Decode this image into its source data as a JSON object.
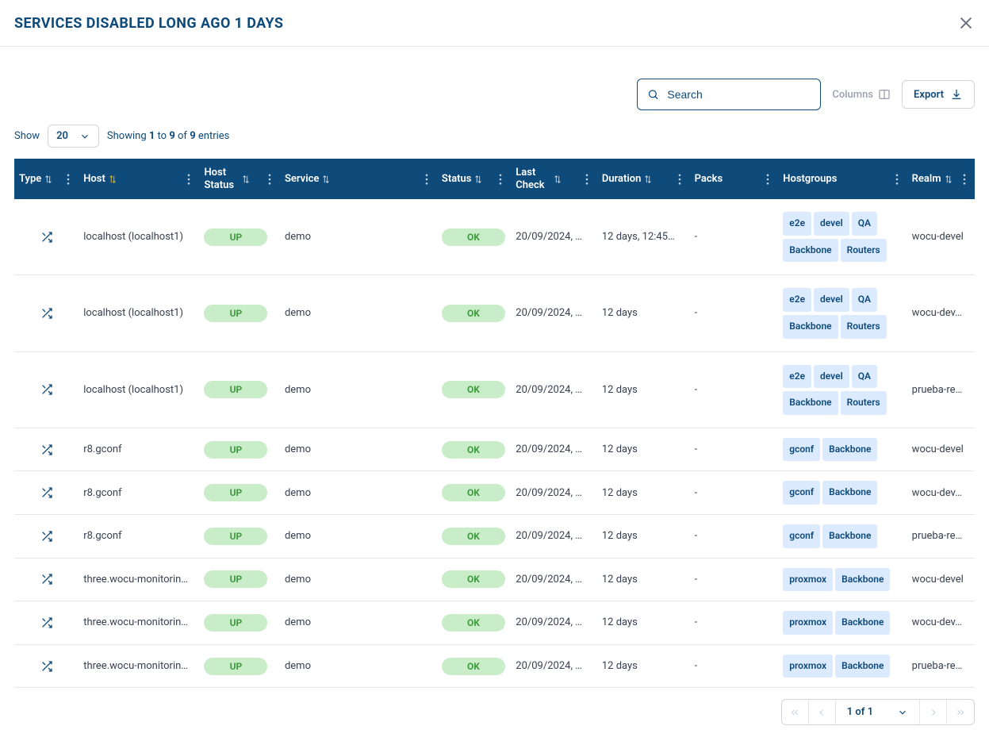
{
  "header": {
    "title": "SERVICES DISABLED LONG AGO 1 DAYS"
  },
  "toolbar": {
    "search_placeholder": "Search",
    "columns_label": "Columns",
    "export_label": "Export"
  },
  "entries": {
    "show_label": "Show",
    "show_value": "20",
    "showing_prefix": "Showing ",
    "from": "1",
    "to_word": " to ",
    "to": "9",
    "of_word": " of ",
    "total": "9",
    "entries_word": " entries"
  },
  "columns": {
    "type": "Type",
    "host": "Host",
    "host_status": "Host Status",
    "service": "Service",
    "status": "Status",
    "last_check": "Last Check",
    "duration": "Duration",
    "packs": "Packs",
    "hostgroups": "Hostgroups",
    "realm": "Realm"
  },
  "rows": [
    {
      "host": "localhost (localhost1)",
      "host_status": "UP",
      "service": "demo",
      "status": "OK",
      "last_check": "20/09/2024, …",
      "duration": "12 days, 12:45…",
      "packs": "-",
      "hostgroups": [
        "e2e",
        "devel",
        "QA",
        "Backbone",
        "Routers"
      ],
      "realm": "wocu-devel"
    },
    {
      "host": "localhost (localhost1)",
      "host_status": "UP",
      "service": "demo",
      "status": "OK",
      "last_check": "20/09/2024, …",
      "duration": "12 days",
      "packs": "-",
      "hostgroups": [
        "e2e",
        "devel",
        "QA",
        "Backbone",
        "Routers"
      ],
      "realm": "wocu-dev…"
    },
    {
      "host": "localhost (localhost1)",
      "host_status": "UP",
      "service": "demo",
      "status": "OK",
      "last_check": "20/09/2024, …",
      "duration": "12 days",
      "packs": "-",
      "hostgroups": [
        "e2e",
        "devel",
        "QA",
        "Backbone",
        "Routers"
      ],
      "realm": "prueba-re…"
    },
    {
      "host": "r8.gconf",
      "host_status": "UP",
      "service": "demo",
      "status": "OK",
      "last_check": "20/09/2024, …",
      "duration": "12 days",
      "packs": "-",
      "hostgroups": [
        "gconf",
        "Backbone"
      ],
      "realm": "wocu-devel"
    },
    {
      "host": "r8.gconf",
      "host_status": "UP",
      "service": "demo",
      "status": "OK",
      "last_check": "20/09/2024, …",
      "duration": "12 days",
      "packs": "-",
      "hostgroups": [
        "gconf",
        "Backbone"
      ],
      "realm": "wocu-dev…"
    },
    {
      "host": "r8.gconf",
      "host_status": "UP",
      "service": "demo",
      "status": "OK",
      "last_check": "20/09/2024, …",
      "duration": "12 days",
      "packs": "-",
      "hostgroups": [
        "gconf",
        "Backbone"
      ],
      "realm": "prueba-re…"
    },
    {
      "host": "three.wocu-monitorin…",
      "host_status": "UP",
      "service": "demo",
      "status": "OK",
      "last_check": "20/09/2024, …",
      "duration": "12 days",
      "packs": "-",
      "hostgroups": [
        "proxmox",
        "Backbone"
      ],
      "realm": "wocu-devel"
    },
    {
      "host": "three.wocu-monitorin…",
      "host_status": "UP",
      "service": "demo",
      "status": "OK",
      "last_check": "20/09/2024, …",
      "duration": "12 days",
      "packs": "-",
      "hostgroups": [
        "proxmox",
        "Backbone"
      ],
      "realm": "wocu-dev…"
    },
    {
      "host": "three.wocu-monitorin…",
      "host_status": "UP",
      "service": "demo",
      "status": "OK",
      "last_check": "20/09/2024, …",
      "duration": "12 days",
      "packs": "-",
      "hostgroups": [
        "proxmox",
        "Backbone"
      ],
      "realm": "prueba-re…"
    }
  ],
  "pagination": {
    "label": "1 of 1"
  }
}
